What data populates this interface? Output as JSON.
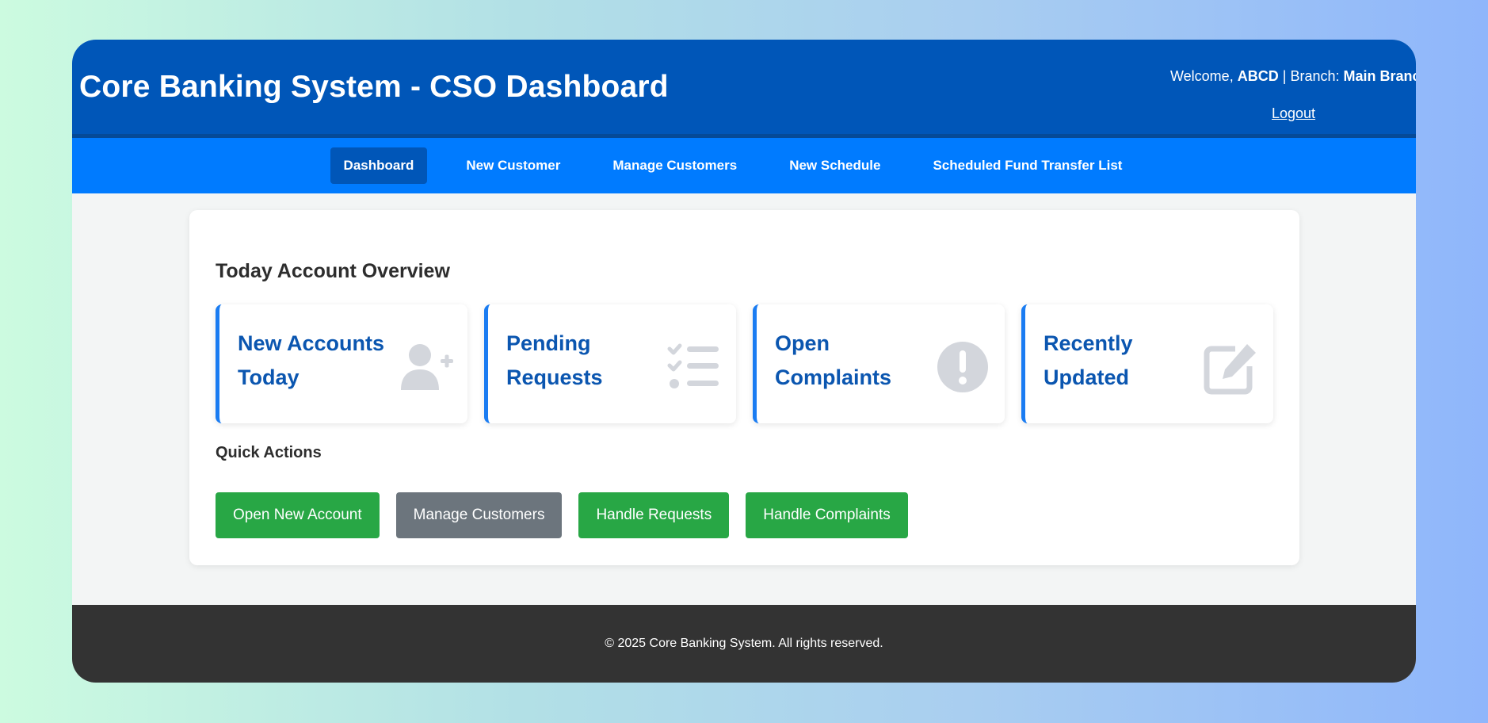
{
  "header": {
    "title": "Core Banking System - CSO Dashboard",
    "welcome_prefix": "Welcome,",
    "user": "ABCD",
    "separator": "|",
    "branch_prefix": "Branch:",
    "branch": "Main Branch",
    "logout": "Logout"
  },
  "nav": {
    "items": [
      {
        "label": "Dashboard",
        "active": true
      },
      {
        "label": "New Customer"
      },
      {
        "label": "Manage Customers"
      },
      {
        "label": "New Schedule"
      },
      {
        "label": "Scheduled Fund Transfer List"
      }
    ]
  },
  "overview": {
    "title": "Today Account Overview",
    "stats": [
      {
        "label": "New Accounts Today",
        "icon": "user-plus-icon"
      },
      {
        "label": "Pending Requests",
        "icon": "checklist-icon"
      },
      {
        "label": "Open Complaints",
        "icon": "exclamation-circle-icon"
      },
      {
        "label": "Recently Updated",
        "icon": "edit-icon"
      }
    ]
  },
  "quick_actions": {
    "title": "Quick Actions",
    "buttons": [
      {
        "label": "Open New Account",
        "color": "#28a745"
      },
      {
        "label": "Manage Customers",
        "color": "#6c757d"
      },
      {
        "label": "Handle Requests",
        "color": "#28a745"
      },
      {
        "label": "Handle Complaints",
        "color": "#28a745"
      }
    ]
  },
  "footer": {
    "text": "© 2025 Core Banking System. All rights reserved."
  },
  "colors": {
    "header_bg": "#0056b8",
    "nav_bg": "#007bff",
    "accent_text": "#0b56b0",
    "icon_gray": "#d3d6dc",
    "footer_bg": "#333333"
  }
}
